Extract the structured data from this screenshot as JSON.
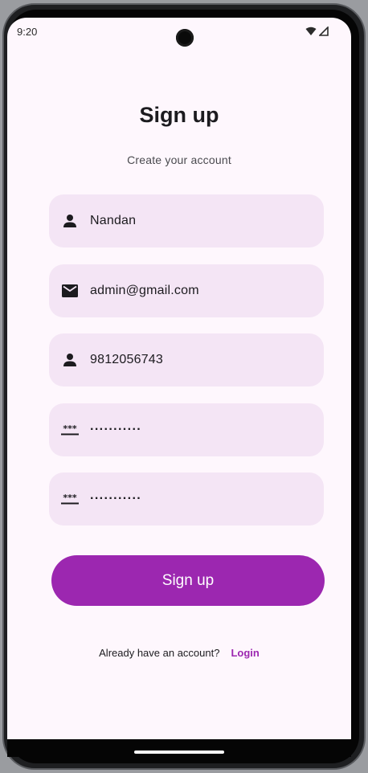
{
  "status_bar": {
    "time": "9:20",
    "wifi_icon": "wifi-icon",
    "signal_icon": "signal-icon"
  },
  "header": {
    "title": "Sign up",
    "subtitle": "Create your account"
  },
  "form": {
    "name": {
      "value": "Nandan",
      "icon": "person-icon"
    },
    "email": {
      "value": "admin@gmail.com",
      "icon": "mail-icon"
    },
    "phone": {
      "value": "9812056743",
      "icon": "person-icon"
    },
    "password": {
      "value": "···········",
      "icon": "password-icon"
    },
    "confirm_password": {
      "value": "···········",
      "icon": "password-icon"
    }
  },
  "actions": {
    "signup_label": "Sign up"
  },
  "footer": {
    "prompt": "Already have an account?",
    "login_label": "Login"
  },
  "colors": {
    "background": "#fef7fd",
    "field_background": "#f4e5f5",
    "accent": "#9c27b0",
    "text": "#1c1b1f"
  }
}
